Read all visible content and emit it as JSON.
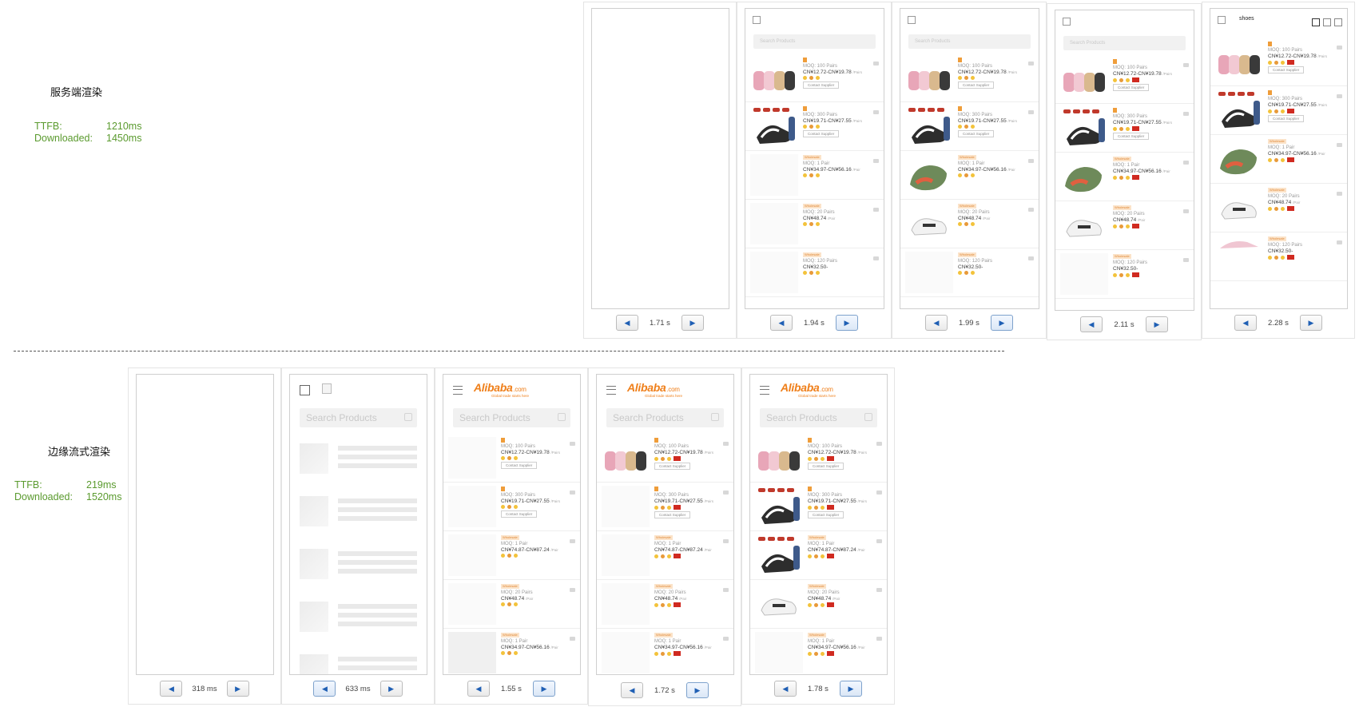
{
  "ssr": {
    "label": "服务端渲染",
    "ttfb_key": "TTFB:",
    "ttfb_val": "1210ms",
    "dl_key": "Downloaded:",
    "dl_val": "1450ms"
  },
  "esr": {
    "label": "边缘流式渲染",
    "ttfb_key": "TTFB:",
    "ttfb_val": "219ms",
    "dl_key": "Downloaded:",
    "dl_val": "1520ms"
  },
  "frames_top": [
    "1.71 s",
    "1.94 s",
    "1.99 s",
    "2.11 s",
    "2.28 s"
  ],
  "frames_bottom": [
    "318 ms",
    "633 ms",
    "1.55 s",
    "1.72 s",
    "1.78 s"
  ],
  "ssr_page": {
    "search_placeholder": "Search Products",
    "search_text": "shoes",
    "items": [
      {
        "moq": "MOQ: 100 Pairs",
        "price": "CN&yen;12.72-CN&yen;19.78",
        "unit": "/Pairs",
        "contact": "Contact Supplier"
      },
      {
        "moq": "MOQ: 300 Pairs",
        "price": "CN&yen;19.71-CN&yen;27.55",
        "unit": "/Pairs",
        "contact": "Contact Supplier"
      },
      {
        "tag": "Wholesale",
        "moq": "MOQ: 1 Pair",
        "price": "CN&yen;34.97-CN&yen;56.16",
        "unit": "/Pair"
      },
      {
        "tag": "Wholesale",
        "moq": "MOQ: 20 Pairs",
        "price": "CN&yen;48.74",
        "unit": "/Pair"
      },
      {
        "tag": "Wholesale",
        "moq": "MOQ: 120 Pairs",
        "price": "CN&yen;32.50-"
      }
    ]
  },
  "esr_page": {
    "logo": "Alibaba",
    "logo_suffix": ".com",
    "tagline": "Global trade starts here",
    "search_placeholder": "Search Products",
    "items": [
      {
        "moq": "MOQ: 100 Pairs",
        "price": "CN¥12.72-CN¥19.78",
        "unit": "/Pairs",
        "contact": "Contact Supplier"
      },
      {
        "moq": "MOQ: 300 Pairs",
        "price": "CN¥19.71-CN¥27.55",
        "unit": "/Pairs",
        "contact": "Contact Supplier"
      },
      {
        "tag": "Wholesale",
        "moq": "MOQ: 1 Pair",
        "price": "CN¥74.87-CN¥87.24",
        "unit": "/Pair"
      },
      {
        "tag": "Wholesale",
        "moq": "MOQ: 20 Pairs",
        "price": "CN¥48.74",
        "unit": "/Pair"
      },
      {
        "tag": "Wholesale",
        "moq": "MOQ: 1 Pair",
        "price": "CN¥34.97-CN¥56.16",
        "unit": "/Pair"
      }
    ]
  },
  "icons": {
    "prev": "triangle-left-icon",
    "next": "triangle-right-icon",
    "menu": "hamburger-icon",
    "camera": "camera-icon"
  },
  "colors": {
    "metrics_green": "#5a9a2e",
    "brand_orange": "#ef7f1a",
    "nav_blue": "#1f5fb4"
  }
}
